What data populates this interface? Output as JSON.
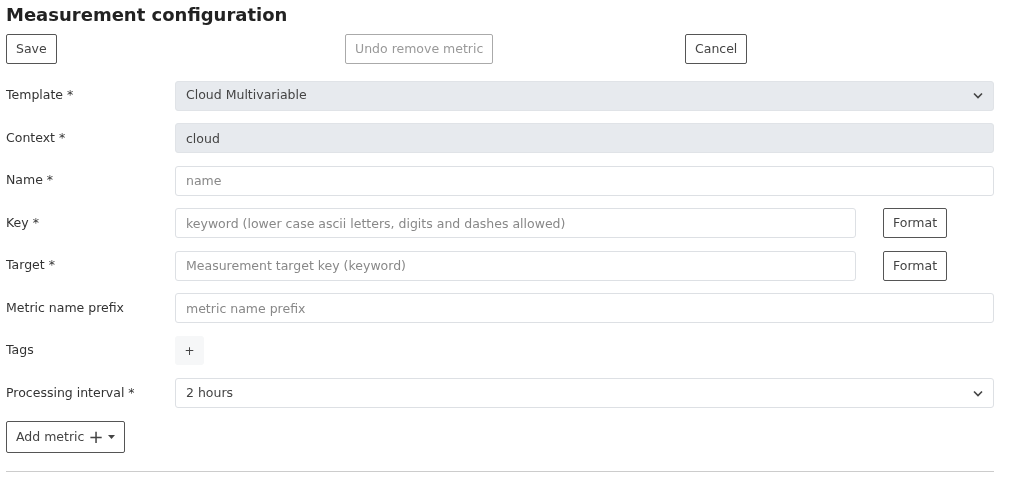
{
  "title": "Measurement configuration",
  "actions": [
    {
      "label": "Save",
      "disabled": false
    },
    {
      "label": "Undo remove metric",
      "disabled": true
    },
    {
      "label": "Cancel",
      "disabled": false
    }
  ],
  "fields": [
    {
      "kind": "select",
      "label": "Template *",
      "value": "Cloud Multivariable",
      "disabled": true
    },
    {
      "kind": "text",
      "label": "Context *",
      "value": "cloud",
      "disabled": true
    },
    {
      "kind": "text",
      "label": "Name *",
      "placeholder": "name",
      "disabled": false
    },
    {
      "kind": "text",
      "label": "Key *",
      "placeholder": "keyword (lower case ascii letters, digits and dashes allowed)",
      "disabled": false,
      "button": "Format"
    },
    {
      "kind": "text",
      "label": "Target *",
      "placeholder": "Measurement target key (keyword)",
      "disabled": false,
      "button": "Format"
    },
    {
      "kind": "text",
      "label": "Metric name prefix",
      "placeholder": "metric name prefix",
      "disabled": false
    },
    {
      "kind": "tags",
      "label": "Tags",
      "add": "+"
    },
    {
      "kind": "select",
      "label": "Processing interval *",
      "value": "2 hours",
      "disabled": false
    }
  ],
  "add_metric": {
    "label": "Add metric",
    "icon": "+"
  }
}
